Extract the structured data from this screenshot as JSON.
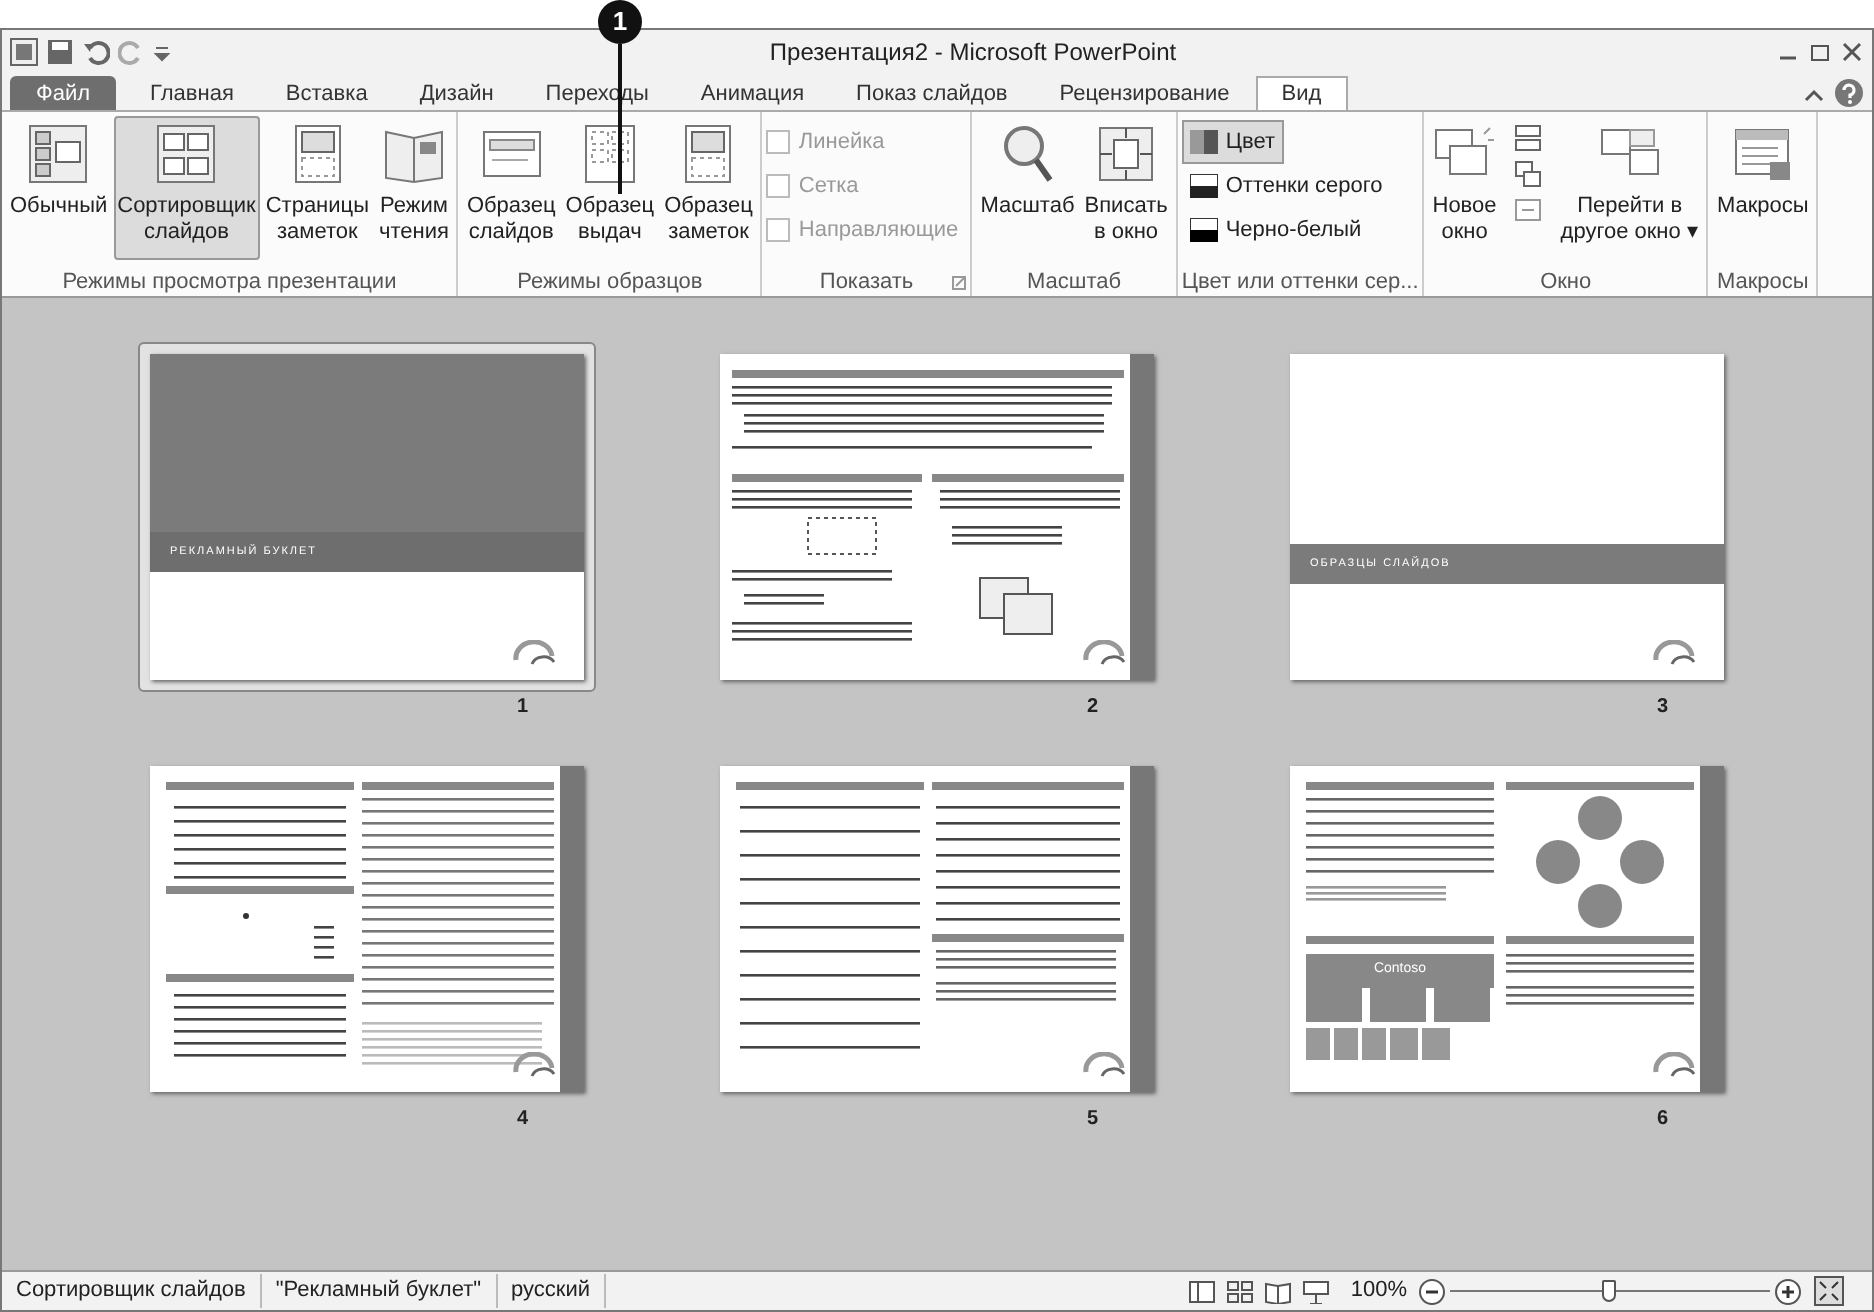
{
  "callout": {
    "number": "1"
  },
  "window": {
    "title": "Презентация2 - Microsoft PowerPoint"
  },
  "tabs": [
    {
      "label": "Файл",
      "kind": "file",
      "selected": false
    },
    {
      "label": "Главная",
      "kind": "tab",
      "selected": false
    },
    {
      "label": "Вставка",
      "kind": "tab",
      "selected": false
    },
    {
      "label": "Дизайн",
      "kind": "tab",
      "selected": false
    },
    {
      "label": "Переходы",
      "kind": "tab",
      "selected": false
    },
    {
      "label": "Анимация",
      "kind": "tab",
      "selected": false
    },
    {
      "label": "Показ слайдов",
      "kind": "tab",
      "selected": false
    },
    {
      "label": "Рецензирование",
      "kind": "tab",
      "selected": false
    },
    {
      "label": "Вид",
      "kind": "tab",
      "selected": true
    }
  ],
  "ribbon_groups": [
    {
      "label": "Режимы просмотра презентации",
      "kind": "large",
      "items": [
        {
          "label": "Обычный",
          "kind": "normal",
          "selected": false
        },
        {
          "label": "Сортировщик\nслайдов",
          "kind": "sorter",
          "selected": true
        },
        {
          "label": "Страницы\nзаметок",
          "kind": "notes",
          "selected": false
        },
        {
          "label": "Режим\nчтения",
          "kind": "book",
          "selected": false
        }
      ]
    },
    {
      "label": "Режимы образцов",
      "kind": "large",
      "items": [
        {
          "label": "Образец\nслайдов",
          "kind": "master",
          "selected": false
        },
        {
          "label": "Образец\nвыдач",
          "kind": "handout",
          "selected": false
        },
        {
          "label": "Образец\nзаметок",
          "kind": "notes",
          "selected": false
        }
      ]
    },
    {
      "label": "Показать",
      "kind": "checks",
      "items": [
        {
          "label": "Линейка",
          "checked": false,
          "disabled": true
        },
        {
          "label": "Сетка",
          "checked": false,
          "disabled": true
        },
        {
          "label": "Направляющие",
          "checked": false,
          "disabled": true
        }
      ]
    },
    {
      "label": "Масштаб",
      "kind": "large",
      "items": [
        {
          "label": "Масштаб",
          "kind": "zoom",
          "selected": false
        },
        {
          "label": "Вписать\nв окно",
          "kind": "fit",
          "selected": false
        }
      ]
    },
    {
      "label": "Цвет или оттенки сер...",
      "kind": "colors",
      "items": [
        {
          "label": "Цвет",
          "kind": "color",
          "selected": true
        },
        {
          "label": "Оттенки серого",
          "kind": "gray",
          "selected": false
        },
        {
          "label": "Черно-белый",
          "kind": "bw",
          "selected": false
        }
      ]
    },
    {
      "label": "Окно",
      "kind": "window",
      "items": [
        {
          "label": "Новое\nокно",
          "kind": "newwin",
          "selected": false
        },
        {
          "label": "Перейти в\nдругое окно ▾",
          "kind": "switch",
          "selected": false
        }
      ]
    },
    {
      "label": "Макросы",
      "kind": "large",
      "items": [
        {
          "label": "Макросы",
          "kind": "macro",
          "selected": false
        }
      ]
    }
  ],
  "slides": [
    {
      "number": "1",
      "kind": "title",
      "title": "РЕКЛАМНЫЙ БУКЛЕТ",
      "selected": true
    },
    {
      "number": "2",
      "kind": "text",
      "selected": false
    },
    {
      "number": "3",
      "kind": "section",
      "title": "ОБРАЗЦЫ СЛАЙДОВ",
      "selected": false
    },
    {
      "number": "4",
      "kind": "table",
      "selected": false
    },
    {
      "number": "5",
      "kind": "lines",
      "selected": false
    },
    {
      "number": "6",
      "kind": "diagram",
      "title": "Contoso",
      "selected": false
    }
  ],
  "status_bar": {
    "items": [
      "Сортировщик слайдов",
      "\"Рекламный буклет\"",
      "русский"
    ],
    "zoom": "100%",
    "level": 0.5
  }
}
